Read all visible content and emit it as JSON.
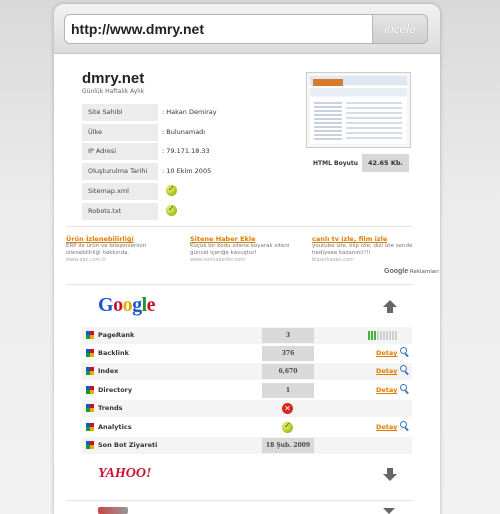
{
  "url_bar": {
    "url": "http://www.dmry.net",
    "button": "incele"
  },
  "site": {
    "title": "dmry.net",
    "subtitle": "Günlük Haftalık Aylık"
  },
  "info": [
    {
      "label": "Site Sahibi",
      "value": ": Hakan Demiray"
    },
    {
      "label": "Ülke",
      "value": ": Bulunamadı"
    },
    {
      "label": "IP Adresi",
      "value": ": 79.171.18.33"
    },
    {
      "label": "Oluşturulma Tarihi",
      "value": ": 10 Ekim 2005"
    },
    {
      "label": "Sitemap.xml",
      "value": ""
    },
    {
      "label": "Robots.txt",
      "value": ""
    }
  ],
  "html_size": {
    "label": "HTML Boyutu",
    "value": "42.65 Kb."
  },
  "ads": [
    {
      "title": "Ürün İzlenebilirliği",
      "body": "ERP ile ürün ve bileşenlerinin izlenebilirliği hakkında.",
      "url": "www.abc.com.tr"
    },
    {
      "title": "Sitene Haber Ekle",
      "body": "Küçük bir kodu sitene koyarak siteni güncel içeriğe kavuştur!",
      "url": "www.sonhaberler.com"
    },
    {
      "title": "canlı tv izle, film izle",
      "body": "youtube izle, klip izle, dizi izle sende hediyeee kazanını!!!!",
      "url": "bizsorkazan.com"
    }
  ],
  "ads_credit": {
    "brand": "Google",
    "suffix": "Reklamları"
  },
  "google": {
    "logo": "Google",
    "rows": [
      {
        "label": "PageRank",
        "value": "3",
        "pagerank": 3
      },
      {
        "label": "Backlink",
        "value": "376",
        "action": "Detay"
      },
      {
        "label": "Index",
        "value": "6,670",
        "action": "Detay"
      },
      {
        "label": "Directory",
        "value": "1",
        "action": "Detay"
      },
      {
        "label": "Trends",
        "value": ""
      },
      {
        "label": "Analytics",
        "value": "",
        "action": "Detay"
      },
      {
        "label": "Son Bot Ziyareti",
        "value": "18 Şub. 2009"
      }
    ]
  },
  "yahoo": {
    "logo": "YAHOO!"
  }
}
